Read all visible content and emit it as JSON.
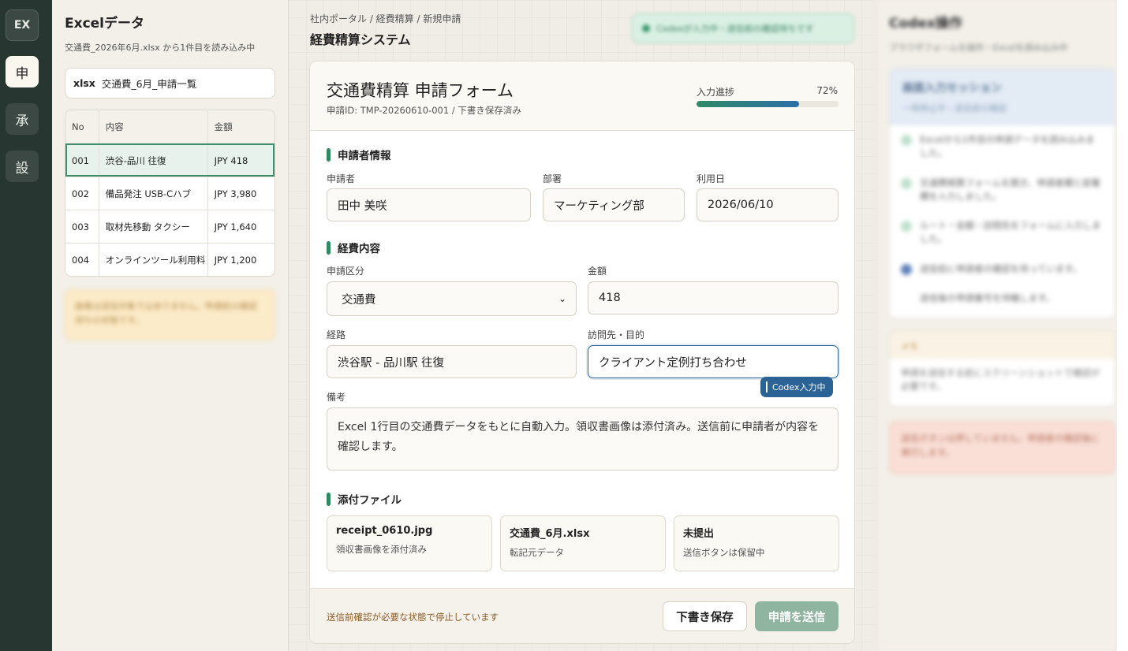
{
  "rail": {
    "items": [
      {
        "label": "EX"
      },
      {
        "label": "申"
      },
      {
        "label": "承"
      },
      {
        "label": "設"
      }
    ]
  },
  "excel": {
    "title": "Excelデータ",
    "subtitle": "交通費_2026年6月.xlsx から1件目を読み込み中",
    "file_ext": "xlsx",
    "file_name": "交通費_6月_申請一覧",
    "columns": [
      "No",
      "内容",
      "金額"
    ],
    "rows": [
      {
        "no": "001",
        "content": "渋谷-品川 往復",
        "amount": "JPY 418"
      },
      {
        "no": "002",
        "content": "備品発注 USB-Cハブ",
        "amount": "JPY 3,980"
      },
      {
        "no": "003",
        "content": "取材先移動 タクシー",
        "amount": "JPY 1,640"
      },
      {
        "no": "004",
        "content": "オンラインツール利用料",
        "amount": "JPY 1,200"
      }
    ],
    "selected_row": 0,
    "note": "画像は送信対象ではありません。申請前の確認待ちの状態です。"
  },
  "center": {
    "breadcrumb": "社内ポータル / 経費精算 / 新規申請",
    "system_title": "経費精算システム",
    "toast": "Codexが入力中・送信前の確認待ちです",
    "form": {
      "title": "交通費精算 申請フォーム",
      "id_line": "申請ID: TMP-20260610-001 / 下書き保存済み",
      "progress_label": "入力進捗",
      "progress_text": "72%",
      "progress_value": 0.72,
      "sections": {
        "applicant": "申請者情報",
        "expense": "経費内容",
        "attachments": "添付ファイル"
      },
      "fields": {
        "applicant": {
          "label": "申請者",
          "value": "田中 美咲"
        },
        "department": {
          "label": "部署",
          "value": "マーケティング部"
        },
        "date": {
          "label": "利用日",
          "value": "2026/06/10"
        },
        "category": {
          "label": "申請区分",
          "value": "交通費"
        },
        "amount": {
          "label": "金額",
          "value": "418"
        },
        "route": {
          "label": "経路",
          "value": "渋谷駅 - 品川駅 往復"
        },
        "purpose": {
          "label": "訪問先・目的",
          "value": "クライアント定例打ち合わせ"
        },
        "remarks": {
          "label": "備考",
          "value": "Excel 1行目の交通費データをもとに自動入力。領収書画像は添付済み。送信前に申請者が内容を確認します。"
        }
      },
      "codex_tag": "Codex入力中",
      "attachments": [
        {
          "name": "receipt_0610.jpg",
          "desc": "領収書画像を添付済み"
        },
        {
          "name": "交通費_6月.xlsx",
          "desc": "転記元データ"
        },
        {
          "name": "未提出",
          "desc": "送信ボタンは保留中"
        }
      ],
      "footer_message": "送信前確認が必要な状態で停止しています",
      "draft_button": "下書き保存",
      "submit_button": "申請を送信"
    }
  },
  "right": {
    "title": "Codex操作",
    "subtitle": "ブラウザフォームを操作・Excelを読み込み中",
    "session_title": "画面入力セッション",
    "session_sub": "一時停止中・送信前の確認",
    "steps": [
      "Excelから1件目の申請データを読み込みました。",
      "交通費精算フォームを開き、申請者欄と部署欄を入力しました。",
      "ルート・金額・訪問先をフォームに入力しました。",
      "送信前に申請者の確認を待っています。",
      "送信後の申請番号を待機します。"
    ],
    "note_head": "メモ",
    "note_body": "申請を送信する前にスクリーンショットで確認が必要です。",
    "warning": "送信ボタンは押していません。申請者の確認後に実行します。"
  },
  "colors": {
    "accent": "#2e8a62",
    "focus": "#2b6396",
    "rail": "#283631",
    "submit": "#8fb49f"
  }
}
